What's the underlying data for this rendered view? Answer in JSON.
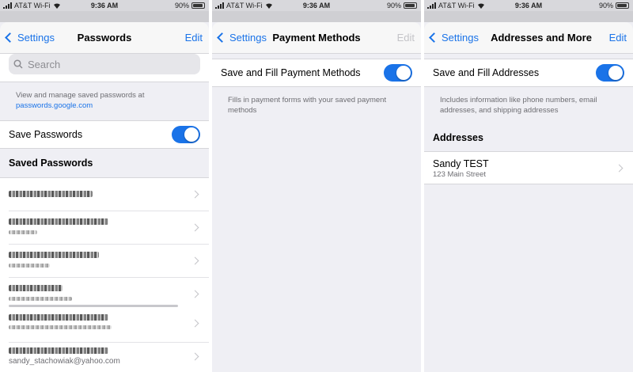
{
  "status_bar": {
    "carrier": "AT&T Wi-Fi",
    "time": "9:36 AM",
    "battery": "90%"
  },
  "colors": {
    "accent": "#1a73e8",
    "background": "#efeff4",
    "secondary_text": "#6d6d72"
  },
  "passwords_screen": {
    "back_label": "Settings",
    "title": "Passwords",
    "edit_label": "Edit",
    "search_placeholder": "Search",
    "info_text": "View and manage saved passwords at",
    "info_link": "passwords.google.com",
    "save_passwords_label": "Save Passwords",
    "save_passwords_on": true,
    "saved_passwords_heading": "Saved Passwords",
    "visible_account_email": "sandy_stachowiak@yahoo.com"
  },
  "payment_screen": {
    "back_label": "Settings",
    "title": "Payment Methods",
    "edit_label": "Edit",
    "toggle_label": "Save and Fill Payment Methods",
    "toggle_on": true,
    "footnote": "Fills in payment forms with your saved payment methods"
  },
  "addresses_screen": {
    "back_label": "Settings",
    "title": "Addresses and More",
    "edit_label": "Edit",
    "toggle_label": "Save and Fill Addresses",
    "toggle_on": true,
    "footnote": "Includes information like phone numbers, email addresses, and shipping addresses",
    "section_heading": "Addresses",
    "address_name": "Sandy TEST",
    "address_street": "123 Main Street"
  }
}
